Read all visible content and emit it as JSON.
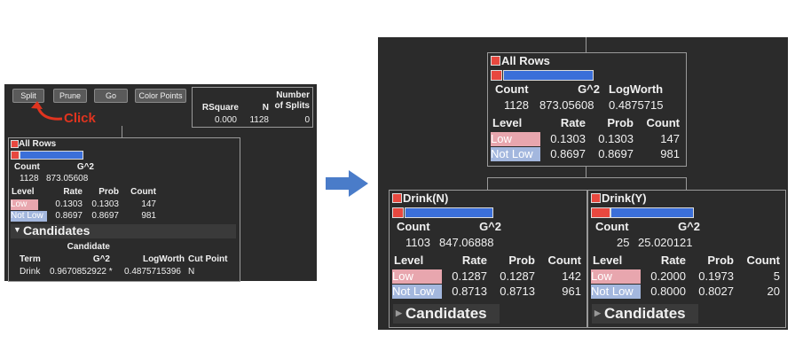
{
  "toolbar": {
    "split": "Split",
    "prune": "Prune",
    "go": "Go",
    "color_points": "Color Points"
  },
  "annotation": {
    "click": "Click"
  },
  "stats": {
    "h_rsquare": "RSquare",
    "h_n": "N",
    "h_splits": "Number\nof Splits",
    "rsquare": "0.000",
    "n": "1128",
    "splits": "0"
  },
  "colors": {
    "low": "#e8a6ae",
    "not_low": "#a3b7de",
    "bar_red": "#e8483f",
    "bar_blue": "#3b6fd9",
    "arrow": "#4a7cc9",
    "click": "#e0341f"
  },
  "left_node": {
    "title": "All Rows",
    "h_count": "Count",
    "h_g2": "G^2",
    "count": "1128",
    "g2": "873.05608",
    "h_level": "Level",
    "h_rate": "Rate",
    "h_prob": "Prob",
    "h_cnt": "Count",
    "rows": [
      {
        "level": "Low",
        "rate": "0.1303",
        "prob": "0.1303",
        "count": "147"
      },
      {
        "level": "Not Low",
        "rate": "0.8697",
        "prob": "0.8697",
        "count": "981"
      }
    ],
    "candidates": {
      "label": "Candidates",
      "h_candidate": "Candidate",
      "h_term": "Term",
      "h_g2": "G^2",
      "h_logworth": "LogWorth",
      "h_cutpoint": "Cut Point",
      "row": {
        "term": "Drink",
        "g2": "0.9670852922 *",
        "logworth": "0.4875715396",
        "cut": "N"
      }
    }
  },
  "root": {
    "title": "All Rows",
    "h_count": "Count",
    "h_g2": "G^2",
    "h_logworth": "LogWorth",
    "count": "1128",
    "g2": "873.05608",
    "logworth": "0.4875715",
    "h_level": "Level",
    "h_rate": "Rate",
    "h_prob": "Prob",
    "h_cnt": "Count",
    "rows": [
      {
        "level": "Low",
        "rate": "0.1303",
        "prob": "0.1303",
        "count": "147"
      },
      {
        "level": "Not Low",
        "rate": "0.8697",
        "prob": "0.8697",
        "count": "981"
      }
    ]
  },
  "child_n": {
    "title": "Drink(N)",
    "h_count": "Count",
    "h_g2": "G^2",
    "count": "1103",
    "g2": "847.06888",
    "h_level": "Level",
    "h_rate": "Rate",
    "h_prob": "Prob",
    "h_cnt": "Count",
    "rows": [
      {
        "level": "Low",
        "rate": "0.1287",
        "prob": "0.1287",
        "count": "142"
      },
      {
        "level": "Not Low",
        "rate": "0.8713",
        "prob": "0.8713",
        "count": "961"
      }
    ],
    "candidates": "Candidates"
  },
  "child_y": {
    "title": "Drink(Y)",
    "h_count": "Count",
    "h_g2": "G^2",
    "count": "25",
    "g2": "25.020121",
    "h_level": "Level",
    "h_rate": "Rate",
    "h_prob": "Prob",
    "h_cnt": "Count",
    "rows": [
      {
        "level": "Low",
        "rate": "0.2000",
        "prob": "0.1973",
        "count": "5"
      },
      {
        "level": "Not Low",
        "rate": "0.8000",
        "prob": "0.8027",
        "count": "20"
      }
    ],
    "candidates": "Candidates"
  }
}
